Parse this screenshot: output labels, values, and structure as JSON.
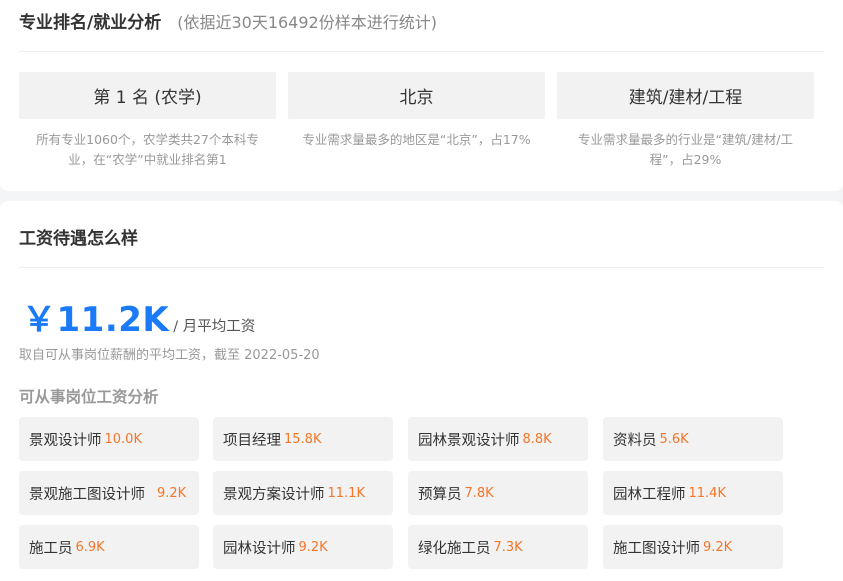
{
  "ranking": {
    "title": "专业排名/就业分析",
    "subtitle": "(依据近30天16492份样本进行统计)",
    "stats": [
      {
        "value": "第 1 名 (农学)",
        "desc": "所有专业1060个，农学类共27个本科专业，在“农学”中就业排名第1"
      },
      {
        "value": "北京",
        "desc": "专业需求量最多的地区是“北京”，占17%"
      },
      {
        "value": "建筑/建材/工程",
        "desc": "专业需求量最多的行业是“建筑/建材/工程”，占29%"
      }
    ]
  },
  "salary": {
    "title": "工资待遇怎么样",
    "value": "￥11.2K",
    "unit": "/ 月平均工资",
    "note": "取自可从事岗位薪酬的平均工资，截至 2022-05-20",
    "jobs_title": "可从事岗位工资分析",
    "jobs": [
      {
        "name": "景观设计师",
        "salary": "10.0K"
      },
      {
        "name": "项目经理",
        "salary": "15.8K"
      },
      {
        "name": "园林景观设计师",
        "salary": "8.8K"
      },
      {
        "name": "资料员",
        "salary": "5.6K"
      },
      {
        "name": "景观施工图设计师",
        "salary": "9.2K"
      },
      {
        "name": "景观方案设计师",
        "salary": "11.1K"
      },
      {
        "name": "预算员",
        "salary": "7.8K"
      },
      {
        "name": "园林工程师",
        "salary": "11.4K"
      },
      {
        "name": "施工员",
        "salary": "6.9K"
      },
      {
        "name": "园林设计师",
        "salary": "9.2K"
      },
      {
        "name": "绿化施工员",
        "salary": "7.3K"
      },
      {
        "name": "施工图设计师",
        "salary": "9.2K"
      }
    ],
    "colors": {
      "salary_value": "#1a7af8",
      "job_salary": "#f5762a"
    }
  }
}
